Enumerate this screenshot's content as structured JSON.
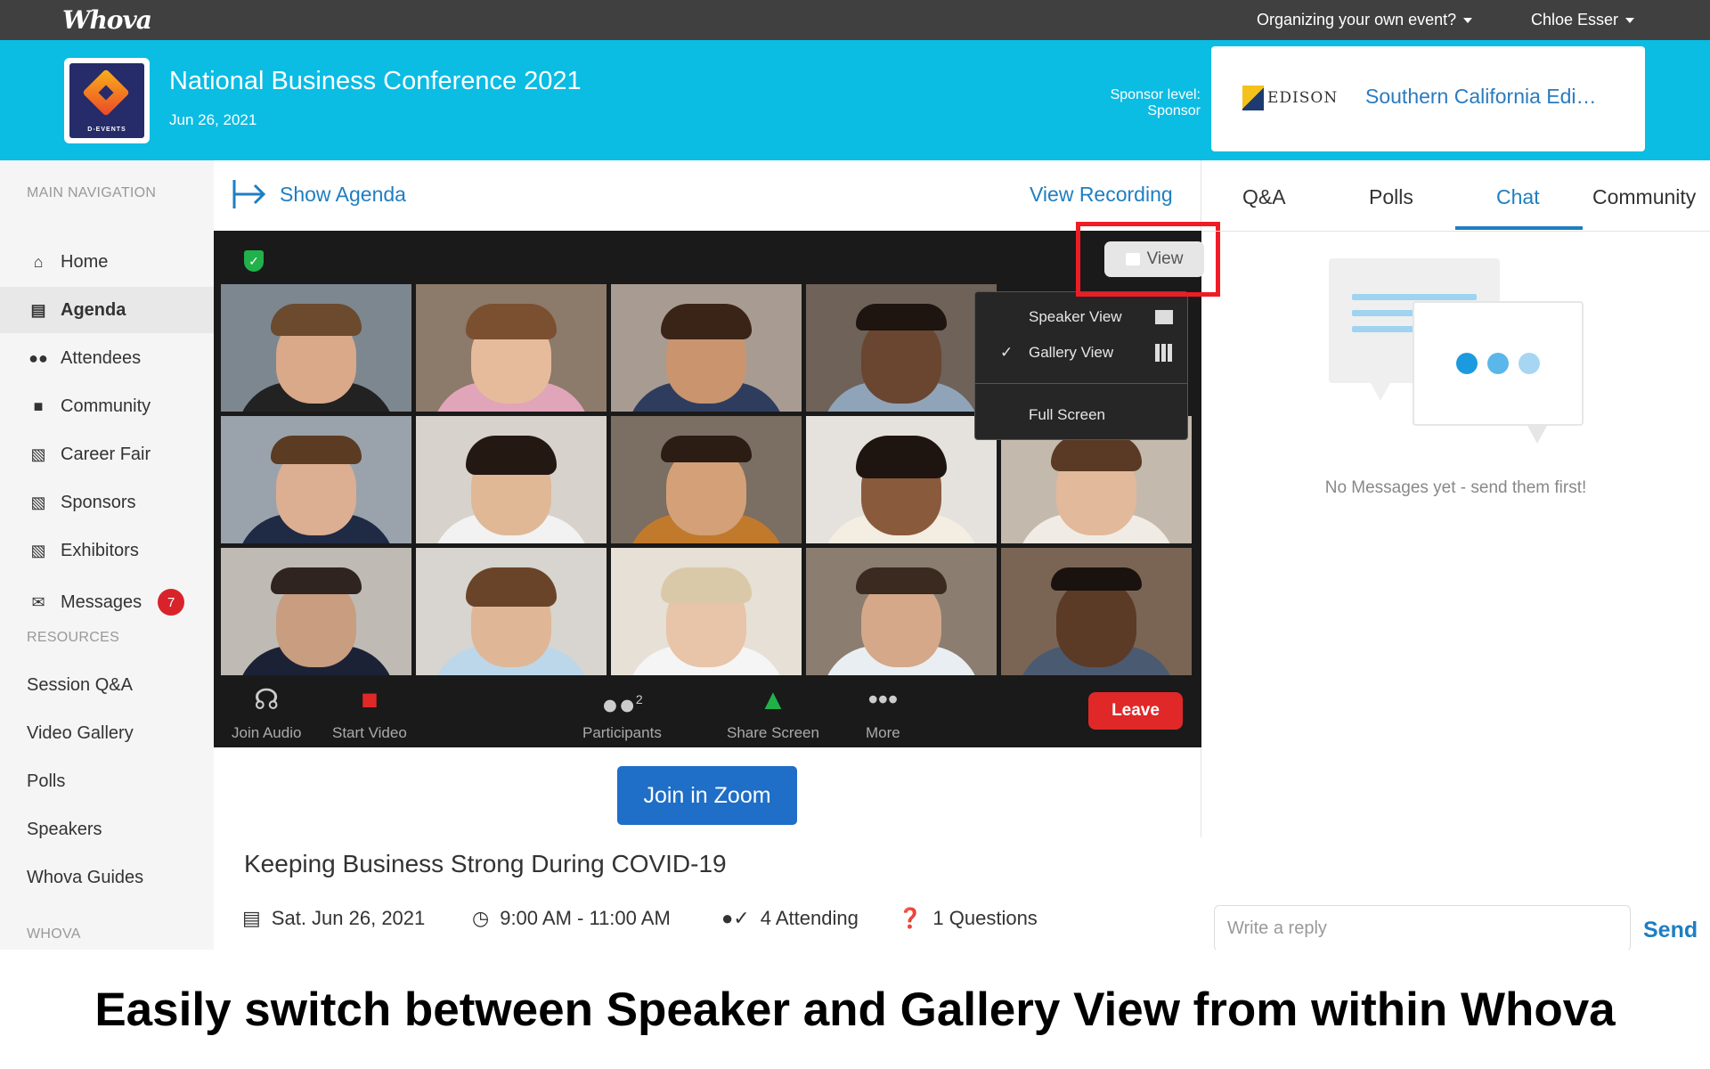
{
  "topbar": {
    "logo": "Whova",
    "organizing_link": "Organizing your own event?",
    "user_name": "Chloe Esser"
  },
  "event": {
    "logo_label": "D-EVENTS",
    "title": "National Business Conference 2021",
    "date": "Jun 26, 2021",
    "sponsor_level_label": "Sponsor level:",
    "sponsor_level_value": "Sponsor",
    "sponsor_logo_text": "EDISON",
    "sponsor_name": "Southern California Edi…"
  },
  "sidebar": {
    "main_nav_heading": "MAIN NAVIGATION",
    "items": [
      {
        "label": "Home",
        "icon": "home-icon"
      },
      {
        "label": "Agenda",
        "icon": "calendar-icon",
        "active": true
      },
      {
        "label": "Attendees",
        "icon": "users-icon"
      },
      {
        "label": "Community",
        "icon": "comments-icon"
      },
      {
        "label": "Career Fair",
        "icon": "building-icon"
      },
      {
        "label": "Sponsors",
        "icon": "building-icon"
      },
      {
        "label": "Exhibitors",
        "icon": "building-icon"
      },
      {
        "label": "Messages",
        "icon": "envelope-icon",
        "badge": "7"
      }
    ],
    "resources_heading": "RESOURCES",
    "resources": [
      "Session Q&A",
      "Video Gallery",
      "Polls",
      "Speakers",
      "Whova Guides"
    ],
    "whova_heading": "WHOVA"
  },
  "main": {
    "show_agenda": "Show Agenda",
    "view_recording": "View Recording",
    "join_zoom": "Join in Zoom",
    "session_title": "Keeping Business Strong During COVID-19",
    "session_date": "Sat. Jun 26, 2021",
    "session_time": "9:00 AM - 11:00 AM",
    "attending": "4 Attending",
    "questions": "1 Questions"
  },
  "zoom": {
    "view_button": "View",
    "menu": {
      "speaker_view": "Speaker View",
      "gallery_view": "Gallery View",
      "gallery_selected": true,
      "full_screen": "Full Screen"
    },
    "toolbar": {
      "join_audio": "Join Audio",
      "start_video": "Start Video",
      "participants": "Participants",
      "participant_count": "2",
      "share_screen": "Share Screen",
      "more": "More",
      "leave": "Leave"
    }
  },
  "right_panel": {
    "tabs": [
      "Q&A",
      "Polls",
      "Chat",
      "Community"
    ],
    "active_tab": "Chat",
    "no_messages": "No Messages yet - send them first!",
    "reply_placeholder": "Write a reply",
    "send": "Send"
  },
  "caption": "Easily switch between Speaker and Gallery View from within Whova",
  "colors": {
    "header": "#0bbce3",
    "link": "#1f7ec1",
    "leave": "#e02828",
    "badge": "#d8232a",
    "highlight": "#ee1c25"
  }
}
